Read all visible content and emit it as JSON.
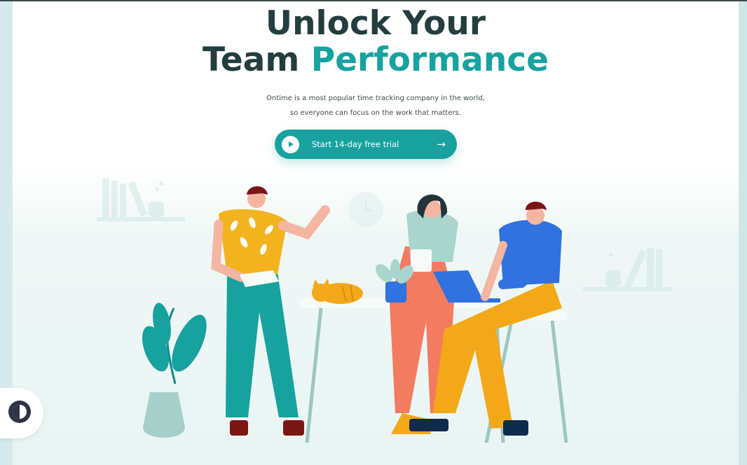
{
  "hero": {
    "title_line1": "Unlock Your",
    "title_line2_plain": "Team",
    "title_line2_accent": "Performance",
    "subtitle_line1": "Ontime is a most popular time tracking company in the world,",
    "subtitle_line2": "so everyone can focus on the work that matters."
  },
  "cta": {
    "label": "Start 14-day free trial",
    "play_icon": "play-icon",
    "arrow_icon": "arrow-right-icon"
  },
  "theme_toggle": {
    "icon": "contrast-icon"
  },
  "colors": {
    "accent": "#17a2a0",
    "heading": "#243e3f",
    "background_tint": "#eaf5f3"
  }
}
